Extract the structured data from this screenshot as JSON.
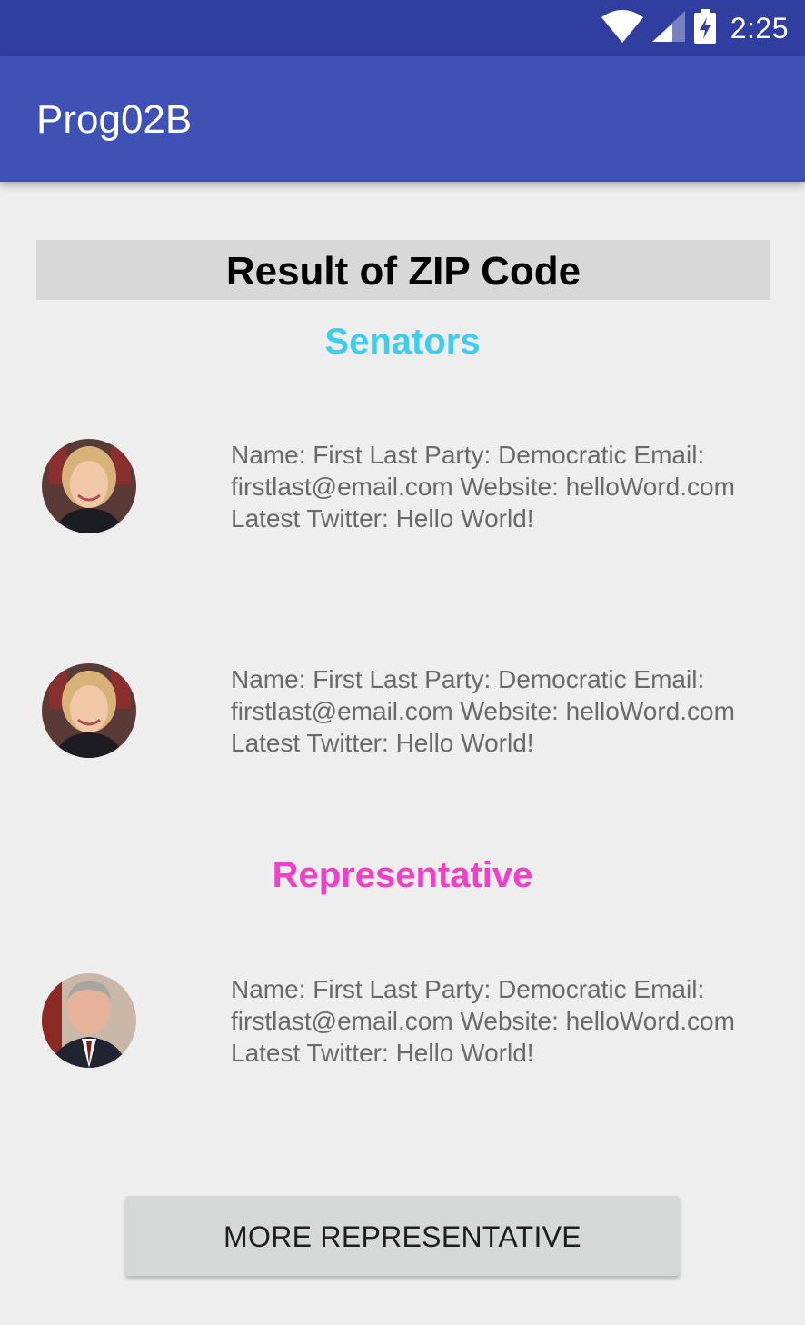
{
  "status_bar": {
    "time": "2:25",
    "icons": [
      "wifi-icon",
      "cell-signal-icon",
      "battery-charging-icon"
    ]
  },
  "app_bar": {
    "title": "Prog02B"
  },
  "result": {
    "title": "Result of ZIP Code"
  },
  "sections": {
    "senators_title": "Senators",
    "representative_title": "Representative"
  },
  "senators": [
    {
      "info": "Name: First Last Party: Democratic Email: firstlast@email.com Website: helloWord.com Latest Twitter: Hello World!"
    },
    {
      "info": "Name: First Last Party: Democratic Email: firstlast@email.com Website: helloWord.com Latest Twitter: Hello World!"
    }
  ],
  "representatives": [
    {
      "info": "Name: First Last Party: Democratic Email: firstlast@email.com Website: helloWord.com Latest Twitter: Hello World!"
    }
  ],
  "button": {
    "label": "MORE REPRESENTATIVE"
  },
  "colors": {
    "status_bar": "#303f9f",
    "app_bar": "#3f51b5",
    "senators_title": "#3ccdf0",
    "representative_title": "#f23fca",
    "background": "#eeeeee"
  }
}
